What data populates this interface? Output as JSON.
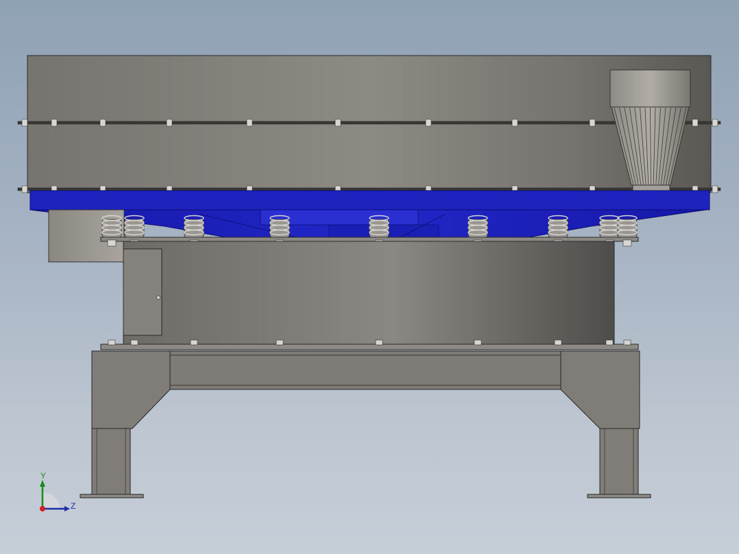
{
  "viewport": {
    "background_top": "#8fa1b5",
    "background_bottom": "#c6ced8"
  },
  "model": {
    "body_color": "#8a8782",
    "base_color": "#1a1fc0",
    "parts": [
      "upper-sieve-frame",
      "discharge-cone",
      "base-frame",
      "spring-set",
      "lower-drum",
      "access-door",
      "side-outlet",
      "support-stand",
      "foot-plate-left",
      "foot-plate-right"
    ]
  },
  "triad": {
    "y_label": "Y",
    "z_label": "Z",
    "y_color": "#1a8a1a",
    "z_color": "#1c2fa8",
    "x_color": "#d02020"
  }
}
